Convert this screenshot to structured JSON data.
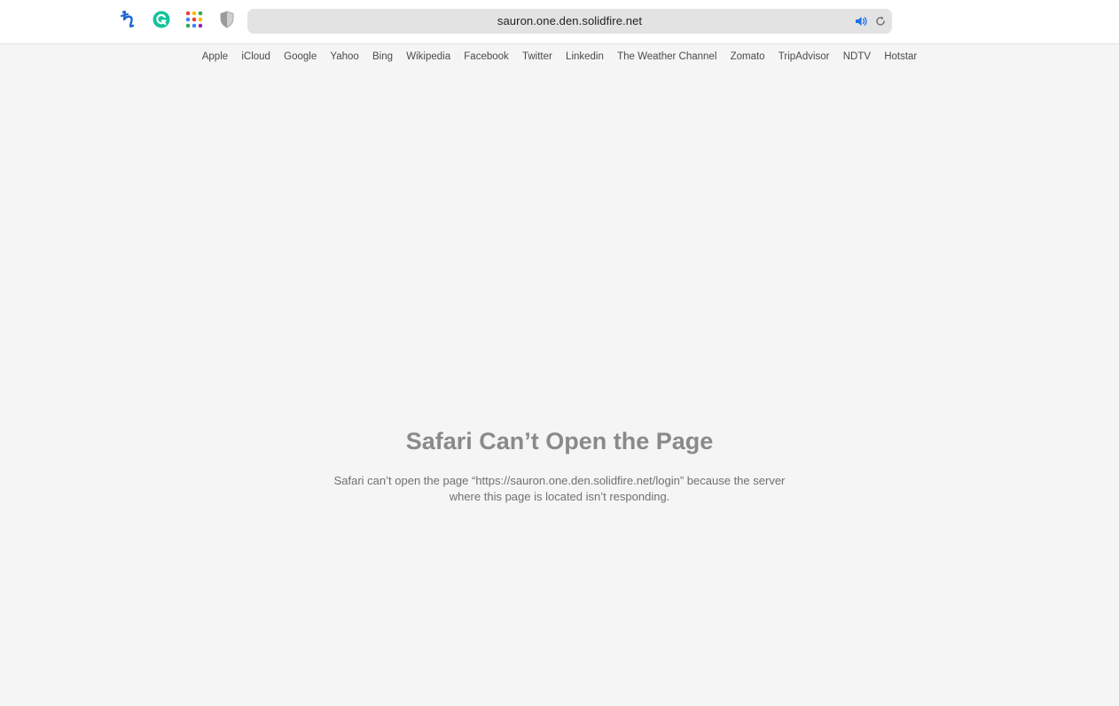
{
  "toolbar": {
    "extensions": [
      {
        "icon": "honey-icon",
        "color": "#1e66d6"
      },
      {
        "icon": "grammarly-icon",
        "color": "#15c39a"
      },
      {
        "icon": "apps-grid-icon"
      },
      {
        "icon": "privacy-shield-icon",
        "color": "#b5b5b5"
      }
    ],
    "address": "sauron.one.den.solidfire.net",
    "speaker_icon": "speaker-icon",
    "reload_icon": "reload-icon",
    "accent_color": "#1a73e8"
  },
  "favorites": [
    "Apple",
    "iCloud",
    "Google",
    "Yahoo",
    "Bing",
    "Wikipedia",
    "Facebook",
    "Twitter",
    "Linkedin",
    "The Weather Channel",
    "Zomato",
    "TripAdvisor",
    "NDTV",
    "Hotstar"
  ],
  "error": {
    "title": "Safari Can’t Open the Page",
    "message": "Safari can’t open the page “https://sauron.one.den.solidfire.net/login” because the server where this page is located isn’t responding."
  }
}
